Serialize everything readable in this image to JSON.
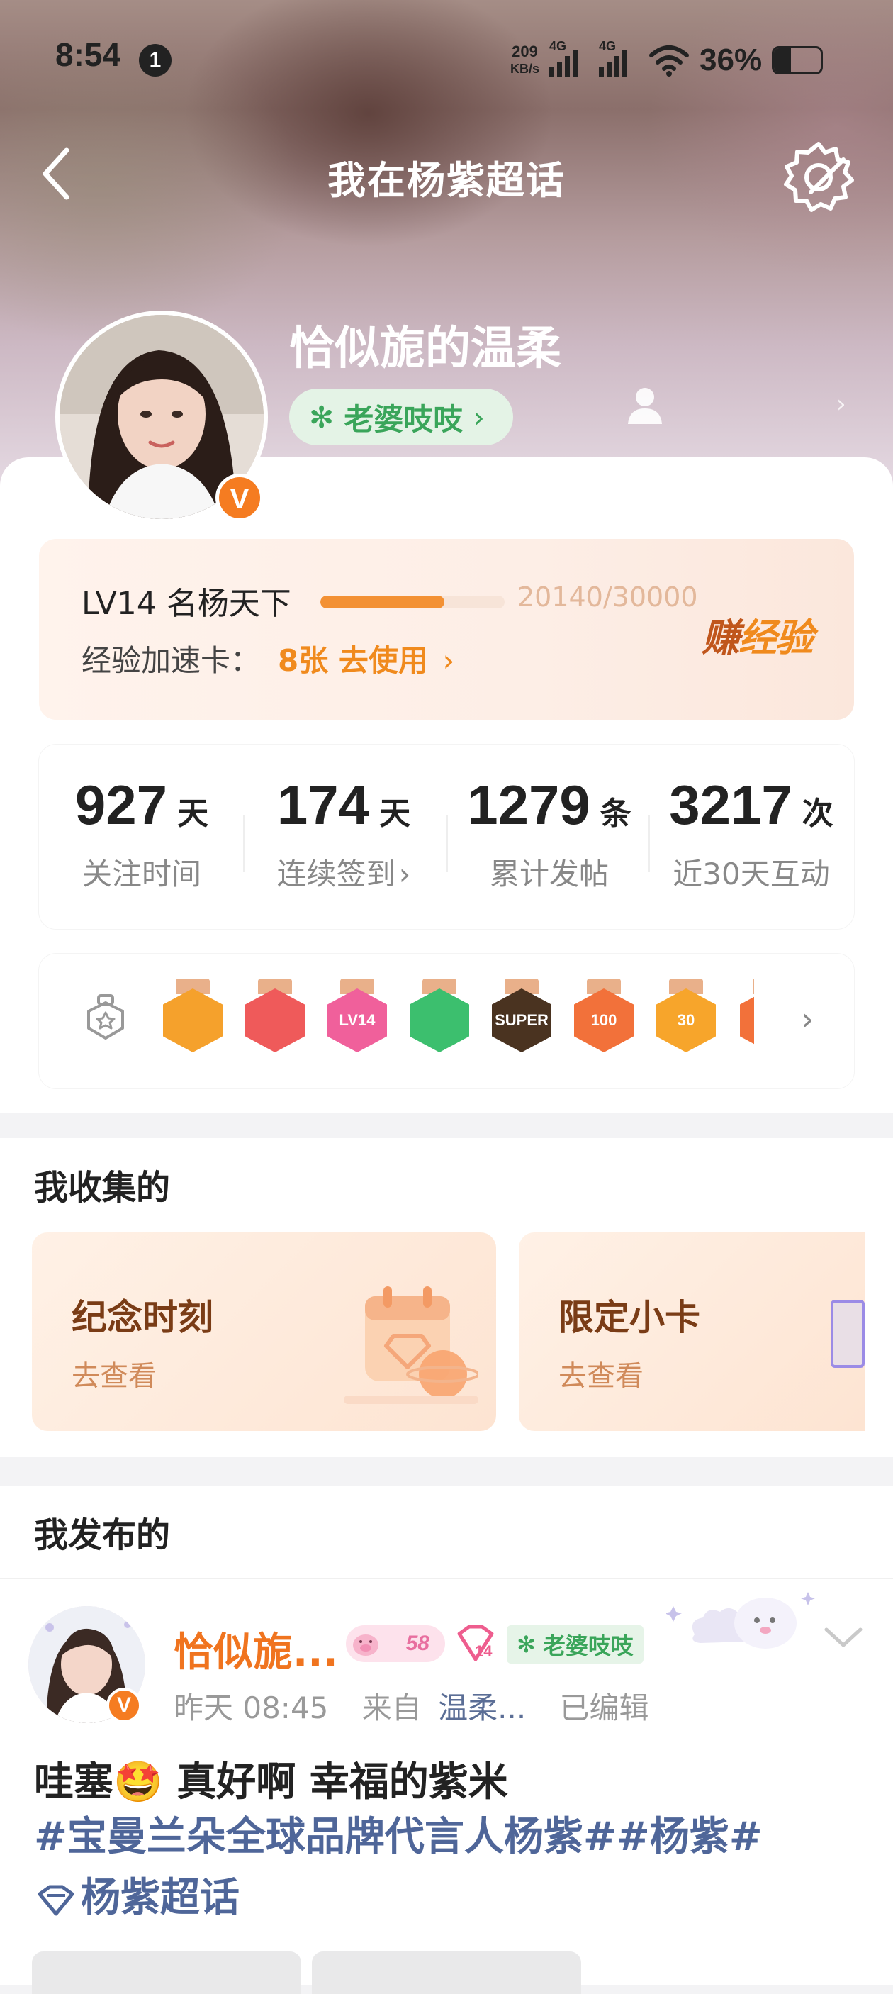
{
  "status_bar": {
    "time": "8:54",
    "notification_count": "1",
    "net_speed_value": "209",
    "net_speed_unit": "KB/s",
    "network_1": "4G",
    "network_2": "4G",
    "battery_percent": "36%",
    "battery_level": 0.36
  },
  "nav": {
    "title": "我在杨紫超话"
  },
  "profile": {
    "username": "恰似旎的温柔",
    "tag_label": "老婆吱吱",
    "tag_color": "#3aa55a",
    "verified_badge": "V"
  },
  "level": {
    "name": "LV14 名杨天下",
    "progress_text": "20140/30000",
    "progress_fraction": 0.6713,
    "speed_card_label": "经验加速卡：",
    "speed_card_value": "8张 去使用",
    "speed_card_arrow": "›",
    "earn_first": "赚",
    "earn_rest": "经验"
  },
  "stats": [
    {
      "value": "927",
      "unit": "天",
      "label": "关注时间"
    },
    {
      "value": "174",
      "unit": "天",
      "label": "连续签到",
      "arrow": "›"
    },
    {
      "value": "1279",
      "unit": "条",
      "label": "累计发帖"
    },
    {
      "value": "3217",
      "unit": "次",
      "label": "近30天互动"
    }
  ],
  "badges": {
    "items": [
      {
        "icon": "crown-medal",
        "text": "",
        "color": "#f5a12c"
      },
      {
        "icon": "trophy-medal",
        "text": "",
        "color": "#ef5a5a"
      },
      {
        "icon": "lv14-medal",
        "text": "LV14",
        "color": "#f0609b"
      },
      {
        "icon": "hand-medal",
        "text": "",
        "color": "#3cbf6e"
      },
      {
        "icon": "super-medal",
        "text": "SUPER",
        "color": "#4a3320"
      },
      {
        "icon": "100-days-medal",
        "text": "100",
        "color": "#f2713a"
      },
      {
        "icon": "30-days-medal",
        "text": "30",
        "color": "#f7a52b"
      }
    ]
  },
  "collected": {
    "title": "我收集的",
    "cards": [
      {
        "title": "纪念时刻",
        "sub": "去查看"
      },
      {
        "title": "限定小卡",
        "sub": "去查看"
      }
    ]
  },
  "published": {
    "title": "我发布的"
  },
  "post": {
    "author": "恰似旎...",
    "lv_badge": "58",
    "fan_level": "14",
    "tag": "老婆吱吱",
    "time": "昨天 08:45",
    "from_prefix": "来自",
    "source": "温柔...",
    "edited": "已编辑",
    "text_before": "哇塞",
    "emoji": "🤩",
    "text_after": " 真好啊 幸福的紫米",
    "hashtags_line1": "#宝曼兰朵全球品牌代言人杨紫##杨紫#",
    "hashtags_line2": "杨紫超话"
  }
}
